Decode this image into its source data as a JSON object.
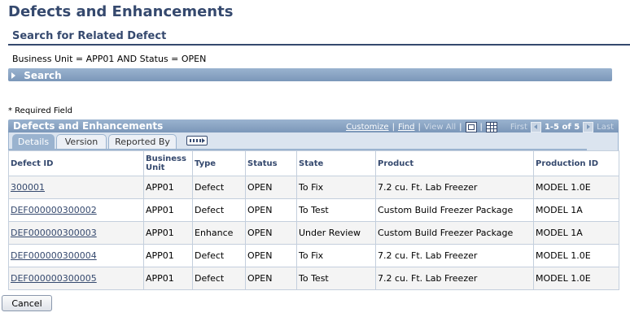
{
  "page": {
    "title": "Defects and Enhancements",
    "subtitle": "Search for Related Defect",
    "criteria": "Business Unit = APP01 AND Status = OPEN",
    "search_label": "Search",
    "required_note": "* Required Field"
  },
  "grid": {
    "title": "Defects and Enhancements",
    "nav": {
      "customize": "Customize",
      "find": "Find",
      "view_all": "View All",
      "first": "First",
      "range": "1-5 of 5",
      "last": "Last",
      "sep": "|"
    },
    "tabs": [
      {
        "label": "Details",
        "active": true
      },
      {
        "label": "Version",
        "active": false
      },
      {
        "label": "Reported By",
        "active": false
      }
    ],
    "columns": [
      "Defect ID",
      "Business Unit",
      "Type",
      "Status",
      "State",
      "Product",
      "Production ID"
    ],
    "rows": [
      {
        "id": "300001",
        "bu": "APP01",
        "type": "Defect",
        "status": "OPEN",
        "state": "To Fix",
        "product": "7.2 cu. Ft. Lab Freezer",
        "prod_id": "MODEL 1.0E"
      },
      {
        "id": "DEF000000300002",
        "bu": "APP01",
        "type": "Defect",
        "status": "OPEN",
        "state": "To Test",
        "product": "Custom Build Freezer Package",
        "prod_id": "MODEL 1A"
      },
      {
        "id": "DEF000000300003",
        "bu": "APP01",
        "type": "Enhance",
        "status": "OPEN",
        "state": "Under Review",
        "product": "Custom Build Freezer Package",
        "prod_id": "MODEL 1A"
      },
      {
        "id": "DEF000000300004",
        "bu": "APP01",
        "type": "Defect",
        "status": "OPEN",
        "state": "To Fix",
        "product": "7.2 cu. Ft. Lab Freezer",
        "prod_id": "MODEL 1.0E"
      },
      {
        "id": "DEF000000300005",
        "bu": "APP01",
        "type": "Defect",
        "status": "OPEN",
        "state": "To Test",
        "product": "7.2 cu. Ft. Lab Freezer",
        "prod_id": "MODEL 1.0E"
      }
    ]
  },
  "actions": {
    "cancel": "Cancel"
  },
  "icons": {
    "search_toggle": "triangle-right-icon",
    "zoom": "zoom-icon",
    "download": "grid-download-icon",
    "show_all_columns": "show-all-columns-icon",
    "prev": "chevron-left-icon",
    "next": "chevron-right-icon"
  },
  "colors": {
    "title": "#35496e",
    "header_bar": "#7b97b9",
    "link": "#35496e"
  }
}
